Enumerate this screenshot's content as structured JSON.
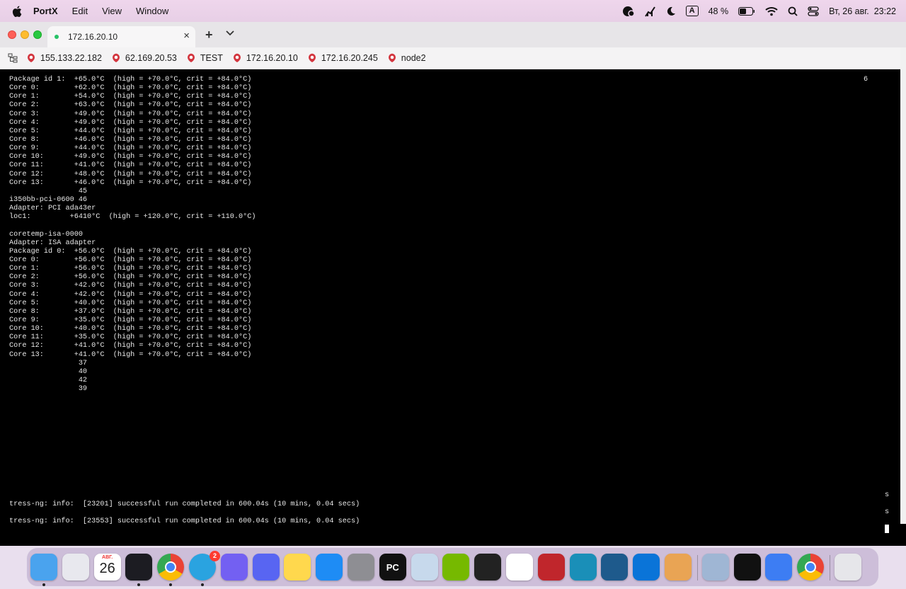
{
  "menubar": {
    "app_name": "PortX",
    "menus": [
      "Edit",
      "View",
      "Window"
    ],
    "battery": "48 %",
    "keyboard": "A",
    "datetime": "Вт, 26 авг.  23:22"
  },
  "tabs": [
    {
      "title": "172.16.20.10",
      "active": true
    }
  ],
  "bookmarks": [
    {
      "label": "155.133.22.182"
    },
    {
      "label": "62.169.20.53"
    },
    {
      "label": "TEST"
    },
    {
      "label": "172.16.20.10"
    },
    {
      "label": "172.16.20.245"
    },
    {
      "label": "node2"
    }
  ],
  "terminal": {
    "lines": [
      "Package id 1:  +65.0°C  (high = +70.0°C, crit = +84.0°C)",
      "Core 0:        +62.0°C  (high = +70.0°C, crit = +84.0°C)",
      "Core 1:        +54.0°C  (high = +70.0°C, crit = +84.0°C)",
      "Core 2:        +63.0°C  (high = +70.0°C, crit = +84.0°C)",
      "Core 3:        +49.0°C  (high = +70.0°C, crit = +84.0°C)",
      "Core 4:        +49.0°C  (high = +70.0°C, crit = +84.0°C)",
      "Core 5:        +44.0°C  (high = +70.0°C, crit = +84.0°C)",
      "Core 8:        +46.0°C  (high = +70.0°C, crit = +84.0°C)",
      "Core 9:        +44.0°C  (high = +70.0°C, crit = +84.0°C)",
      "Core 10:       +49.0°C  (high = +70.0°C, crit = +84.0°C)",
      "Core 11:       +41.0°C  (high = +70.0°C, crit = +84.0°C)",
      "Core 12:       +48.0°C  (high = +70.0°C, crit = +84.0°C)",
      "Core 13:       +46.0°C  (high = +70.0°C, crit = +84.0°C)",
      "                45",
      "i350bb-pci-0600 46",
      "Adapter: PCI ada43er",
      "loc1:         +6410°C  (high = +120.0°C, crit = +110.0°C)",
      "",
      "coretemp-isa-0000",
      "Adapter: ISA adapter",
      "Package id 0:  +56.0°C  (high = +70.0°C, crit = +84.0°C)",
      "Core 0:        +56.0°C  (high = +70.0°C, crit = +84.0°C)",
      "Core 1:        +56.0°C  (high = +70.0°C, crit = +84.0°C)",
      "Core 2:        +56.0°C  (high = +70.0°C, crit = +84.0°C)",
      "Core 3:        +42.0°C  (high = +70.0°C, crit = +84.0°C)",
      "Core 4:        +42.0°C  (high = +70.0°C, crit = +84.0°C)",
      "Core 5:        +40.0°C  (high = +70.0°C, crit = +84.0°C)",
      "Core 8:        +37.0°C  (high = +70.0°C, crit = +84.0°C)",
      "Core 9:        +35.0°C  (high = +70.0°C, crit = +84.0°C)",
      "Core 10:       +40.0°C  (high = +70.0°C, crit = +84.0°C)",
      "Core 11:       +35.0°C  (high = +70.0°C, crit = +84.0°C)",
      "Core 12:       +41.0°C  (high = +70.0°C, crit = +84.0°C)",
      "Core 13:       +41.0°C  (high = +70.0°C, crit = +84.0°C)",
      "                37",
      "                40",
      "                42",
      "                39"
    ],
    "bottom_lines": [
      "tress-ng: info:  [23201] successful run completed in 600.04s (10 mins, 0.04 secs)",
      "tress-ng: info:  [23553] successful run completed in 600.04s (10 mins, 0.04 secs)"
    ],
    "corner_value": "6",
    "side_marks": [
      "s",
      "s"
    ]
  },
  "dock": {
    "calendar_month": "АВГ.",
    "calendar_day": "26",
    "telegram_badge": "2",
    "pycharm_label": "PC",
    "apps": [
      {
        "name": "finder-icon",
        "color": "#4aa3ee"
      },
      {
        "name": "launchpad-icon",
        "color": "#e8e8ee"
      },
      {
        "name": "calendar-icon",
        "color": "#ffffff"
      },
      {
        "name": "portx-icon",
        "color": "#1c1c22"
      },
      {
        "name": "chrome-icon",
        "color": "#ffffff"
      },
      {
        "name": "telegram-icon",
        "color": "#2aa3e0"
      },
      {
        "name": "viber-icon",
        "color": "#7360f2"
      },
      {
        "name": "discord-icon",
        "color": "#5865f2"
      },
      {
        "name": "notes-icon",
        "color": "#ffd84d"
      },
      {
        "name": "app-store-icon",
        "color": "#1e8cf5"
      },
      {
        "name": "system-settings-icon",
        "color": "#8e8e93"
      },
      {
        "name": "pycharm-icon",
        "color": "#111111"
      },
      {
        "name": "postgres-icon",
        "color": "#c7d9ec"
      },
      {
        "name": "nvidia-icon",
        "color": "#76b900"
      },
      {
        "name": "terminal-icon",
        "color": "#222222"
      },
      {
        "name": "google-drive-icon",
        "color": "#ffffff"
      },
      {
        "name": "remote-app-icon",
        "color": "#c0262c"
      },
      {
        "name": "edge-icon",
        "color": "#1a8fb8"
      },
      {
        "name": "activity-monitor-icon",
        "color": "#1e5a8c"
      },
      {
        "name": "windows-app-icon",
        "color": "#0a74d8"
      },
      {
        "name": "photo-app-icon",
        "color": "#e9a454"
      },
      {
        "name": "preview-icon",
        "color": "#9fb6d4"
      },
      {
        "name": "stocks-icon",
        "color": "#111111"
      },
      {
        "name": "roblox-studio-icon",
        "color": "#3d7df3"
      },
      {
        "name": "chrome-canary-icon",
        "color": "#ffffff"
      },
      {
        "name": "trash-icon",
        "color": "#e6e6ea"
      }
    ]
  },
  "colors": {
    "terminal_bg": "#000000",
    "terminal_fg": "#e9e9e9",
    "bookmark_icon": "#d3353e",
    "tab_active_dot": "#27c267"
  }
}
